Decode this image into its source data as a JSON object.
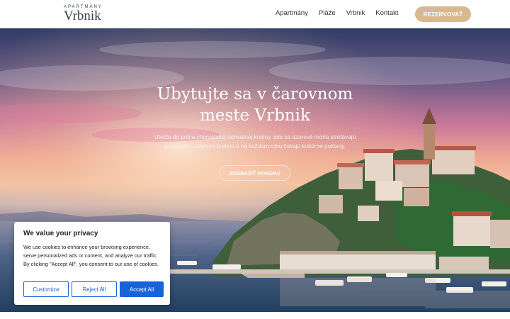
{
  "header": {
    "logo_small": "APARTMÁNY",
    "logo_big": "Vrbnik",
    "nav": [
      "Apartmány",
      "Pláže",
      "Vrbnik",
      "Kontakt"
    ],
    "reserve_label": "REZERVOVAŤ"
  },
  "hero": {
    "title_line1": "Ubytujte sa v čarovnom",
    "title_line2": "meste Vrbnik",
    "subtitle_line1": "Utečte do srdca chorvátskej úchvatnej krajiny, kde sa azúrové moria stretávajú",
    "subtitle_line2": "so slnkom zaliatymi brehmi a na každom rohu čakajú kultúrne poklady.",
    "cta_label": "ZOBRAZIŤ PONUKU"
  },
  "cookie_banner": {
    "title": "We value your privacy",
    "text": "We use cookies to enhance your browsing experience, serve personalized ads or content, and analyze our traffic. By clicking \"Accept All\", you consent to our use of cookies.",
    "customize_label": "Customize",
    "reject_label": "Reject All",
    "accept_label": "Accept All"
  },
  "colors": {
    "accent": "#d9b890",
    "cookie_blue": "#1863dc",
    "text_dark": "#2f3440"
  }
}
